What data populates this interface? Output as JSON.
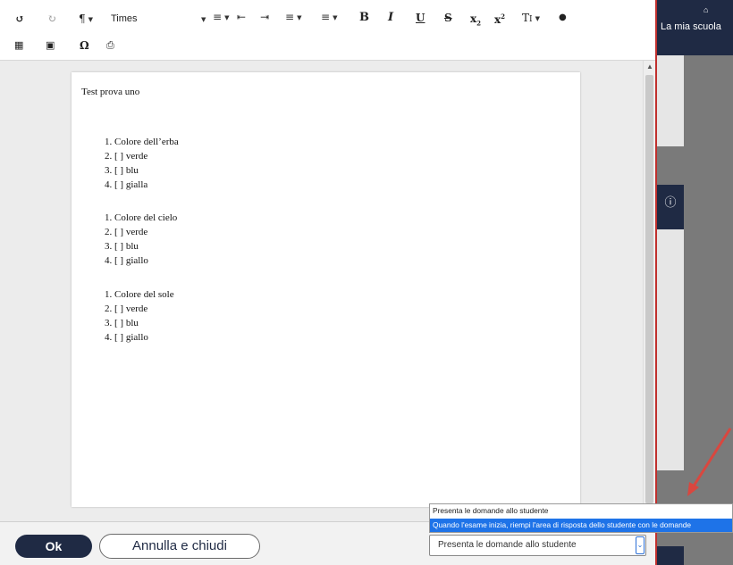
{
  "background_app": {
    "nav_label": "La mia scuola"
  },
  "toolbar": {
    "font_name": "Times"
  },
  "document": {
    "title": "Test prova uno",
    "questions": [
      {
        "items": [
          "1. Colore dell’erba",
          "2. [ ] verde",
          "3. [ ] blu",
          "4. [ ] gialla"
        ]
      },
      {
        "items": [
          "1. Colore del cielo",
          "2. [ ] verde",
          "3. [ ] blu",
          "4. [ ] giallo"
        ]
      },
      {
        "items": [
          "1. Colore del sole",
          "2. [ ] verde",
          "3. [ ] blu",
          "4. [ ] giallo"
        ]
      }
    ]
  },
  "footer": {
    "ok_label": "Ok",
    "cancel_label": "Annulla e chiudi"
  },
  "select": {
    "current_value": "Presenta le domande allo studente",
    "options": [
      "Presenta le domande allo studente",
      "Quando l'esame inizia, riempi l'area di risposta dello studente con le domande"
    ],
    "highlighted_option_index": 1
  },
  "colors": {
    "primary_navy": "#1f2a44",
    "highlight_blue": "#1e73e8",
    "annotation_red": "#d9473f"
  }
}
